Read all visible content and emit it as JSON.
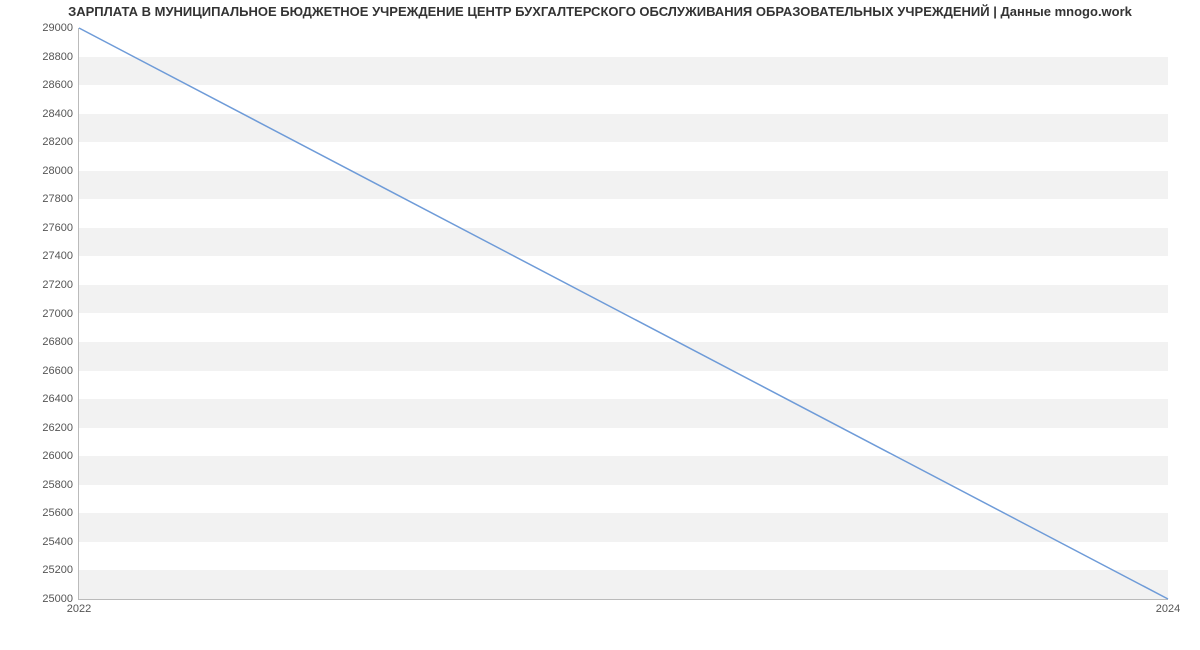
{
  "chart_data": {
    "type": "line",
    "title": "ЗАРПЛАТА В МУНИЦИПАЛЬНОЕ БЮДЖЕТНОЕ УЧРЕЖДЕНИЕ ЦЕНТР БУХГАЛТЕРСКОГО ОБСЛУЖИВАНИЯ ОБРАЗОВАТЕЛЬНЫХ УЧРЕЖДЕНИЙ | Данные mnogo.work",
    "x": [
      2022,
      2024
    ],
    "values": [
      29000,
      25000
    ],
    "xlabel": "",
    "ylabel": "",
    "xlim": [
      2022,
      2024
    ],
    "ylim": [
      25000,
      29000
    ],
    "x_ticks": [
      2022,
      2024
    ],
    "y_ticks": [
      25000,
      25200,
      25400,
      25600,
      25800,
      26000,
      26200,
      26400,
      26600,
      26800,
      27000,
      27200,
      27400,
      27600,
      27800,
      28000,
      28200,
      28400,
      28600,
      28800,
      29000
    ],
    "grid": true,
    "legend": false,
    "series_color": "#6e9bd8"
  }
}
